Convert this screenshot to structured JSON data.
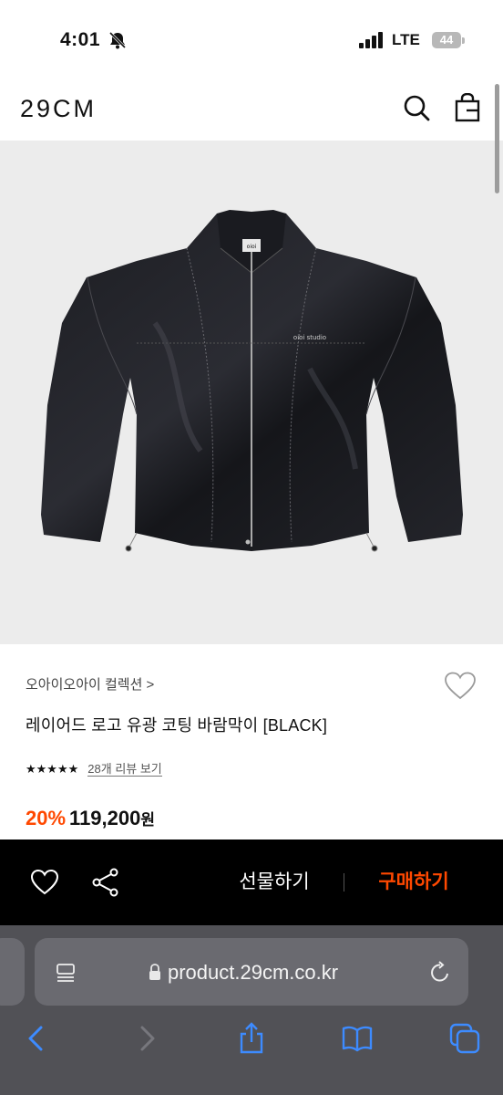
{
  "status_bar": {
    "time": "4:01",
    "network": "LTE",
    "battery": "44"
  },
  "header": {
    "logo": "29CM"
  },
  "product": {
    "brand": "오아이오아이 컬렉션",
    "brand_chevron": ">",
    "title": "레이어드 로고 유광 코팅 바람막이 [BLACK]",
    "stars": "★★★★★",
    "rating": 5,
    "review_link": "28개 리뷰 보기",
    "discount": "20%",
    "price": "119,200",
    "currency": "원",
    "image_label_logo": "oioi",
    "image_label_text": "oioi studio"
  },
  "action_bar": {
    "gift_label": "선물하기",
    "buy_label": "구매하기"
  },
  "browser": {
    "url": "product.29cm.co.kr"
  },
  "colors": {
    "accent": "#ff4800",
    "action_bar_bg": "#000000",
    "safari_bg": "#515156",
    "image_bg": "#ececec"
  }
}
